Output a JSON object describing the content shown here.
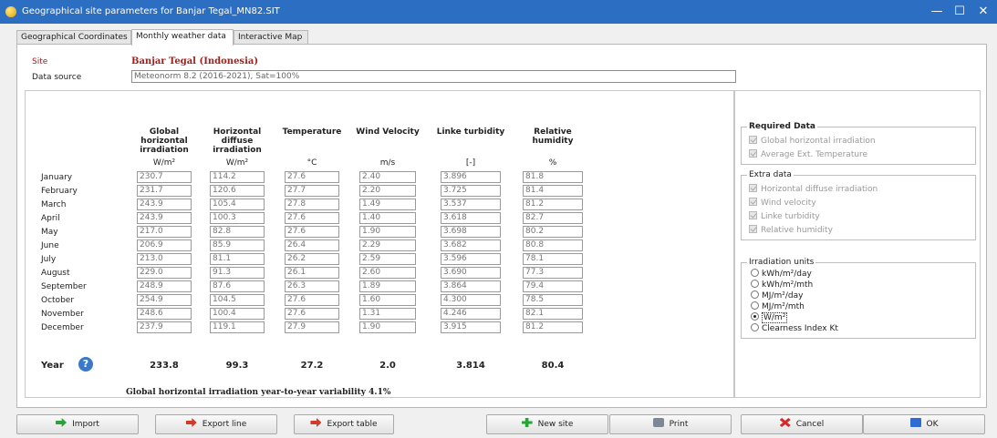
{
  "window": {
    "title": "Geographical site parameters for Banjar Tegal_MN82.SIT",
    "minimize": "—",
    "maximize": "☐",
    "close": "✕"
  },
  "tabs": [
    "Geographical Coordinates",
    "Monthly weather data",
    "Interactive Map"
  ],
  "site": {
    "label": "Site",
    "value": "Banjar Tegal   (Indonesia)"
  },
  "data_source": {
    "label": "Data source",
    "value": "Meteonorm 8.2 (2016-2021), Sat=100%"
  },
  "columns": [
    {
      "header": "Global\nhorizontal\nirradiation",
      "unit": "W/m²"
    },
    {
      "header": "Horizontal\ndiffuse\nirradiation",
      "unit": "W/m²"
    },
    {
      "header": "Temperature",
      "unit": "°C"
    },
    {
      "header": "Wind Velocity",
      "unit": "m/s"
    },
    {
      "header": "Linke turbidity",
      "unit": "[-]"
    },
    {
      "header": "Relative\nhumidity",
      "unit": "%"
    }
  ],
  "months": [
    "January",
    "February",
    "March",
    "April",
    "May",
    "June",
    "July",
    "August",
    "September",
    "October",
    "November",
    "December"
  ],
  "rows": [
    [
      "230.7",
      "114.2",
      "27.6",
      "2.40",
      "3.896",
      "81.8"
    ],
    [
      "231.7",
      "120.6",
      "27.7",
      "2.20",
      "3.725",
      "81.4"
    ],
    [
      "243.9",
      "105.4",
      "27.8",
      "1.49",
      "3.537",
      "81.2"
    ],
    [
      "243.9",
      "100.3",
      "27.6",
      "1.40",
      "3.618",
      "82.7"
    ],
    [
      "217.0",
      "82.8",
      "27.6",
      "1.90",
      "3.698",
      "80.2"
    ],
    [
      "206.9",
      "85.9",
      "26.4",
      "2.29",
      "3.682",
      "80.8"
    ],
    [
      "213.0",
      "81.1",
      "26.2",
      "2.59",
      "3.596",
      "78.1"
    ],
    [
      "229.0",
      "91.3",
      "26.1",
      "2.60",
      "3.690",
      "77.3"
    ],
    [
      "248.9",
      "87.6",
      "26.3",
      "1.89",
      "3.864",
      "79.4"
    ],
    [
      "254.9",
      "104.5",
      "27.6",
      "1.60",
      "4.300",
      "78.5"
    ],
    [
      "248.6",
      "100.4",
      "27.6",
      "1.31",
      "4.246",
      "82.1"
    ],
    [
      "237.9",
      "119.1",
      "27.9",
      "1.90",
      "3.915",
      "81.2"
    ]
  ],
  "year": {
    "label": "Year",
    "values": [
      "233.8",
      "99.3",
      "27.2",
      "2.0",
      "3.814",
      "80.4"
    ]
  },
  "variability": "Global horizontal irradiation year-to-year variability  4.1%",
  "required_data": {
    "title": "Required Data",
    "items": [
      "Global horizontal irradiation",
      "Average Ext. Temperature"
    ]
  },
  "extra_data": {
    "title": "Extra data",
    "items": [
      "Horizontal diffuse irradiation",
      "Wind velocity",
      "Linke turbidity",
      "Relative humidity"
    ]
  },
  "irradiation_units": {
    "title": "Irradiation units",
    "options": [
      "kWh/m²/day",
      "kWh/m²/mth",
      "MJ/m²/day",
      "MJ/m²/mth",
      "W/m²",
      "Clearness Index Kt"
    ],
    "selected": 4
  },
  "buttons": {
    "import": "Import",
    "export_line": "Export line",
    "export_table": "Export table",
    "new_site": "New site",
    "print": "Print",
    "cancel": "Cancel",
    "ok": "OK"
  }
}
